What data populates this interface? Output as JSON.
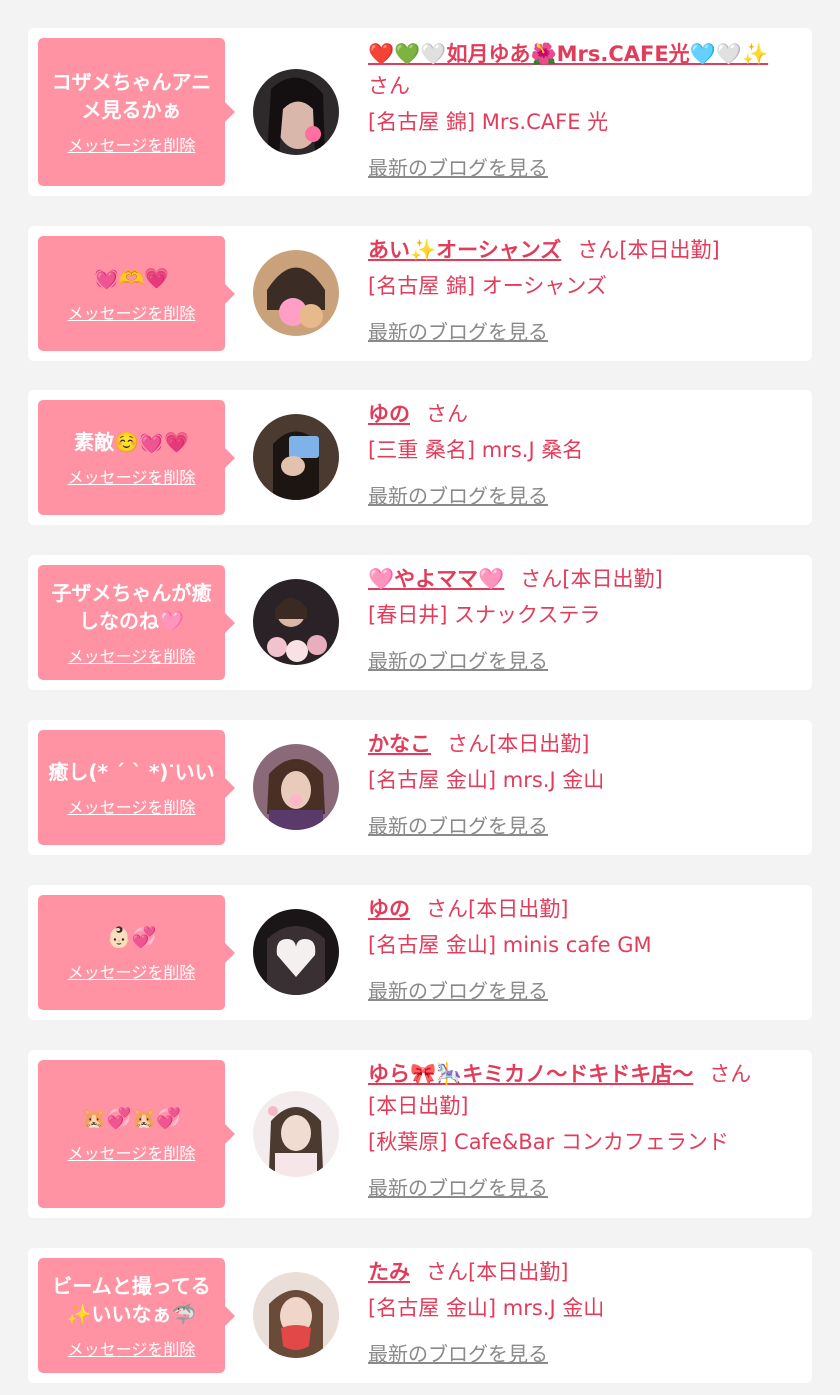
{
  "delete_label": "メッセージを削除",
  "blog_label": "最新のブログを見る",
  "san": "さん",
  "accent_color": "#e13d5b",
  "bubble_color": "#ff93a4",
  "items": [
    {
      "message": "コザメちゃんアニメ見るかぁ",
      "name": "❤️💚🤍如月ゆあ🌺Mrs.CAFE光🩵🤍✨",
      "status": "",
      "shop": "[名古屋 錦] Mrs.CAFE 光"
    },
    {
      "message": "💓🫶💗",
      "name": "あい✨オーシャンズ",
      "status": "[本日出勤]",
      "shop": "[名古屋 錦] オーシャンズ"
    },
    {
      "message": "素敵☺️💓💗",
      "name": "ゆの",
      "status": "",
      "shop": "[三重 桑名] mrs.J 桑名"
    },
    {
      "message": "子ザメちゃんが癒しなのね🩷",
      "name": "🩷やよママ🩷",
      "status": "[本日出勤]",
      "shop": "[春日井] スナックステラ"
    },
    {
      "message": "癒し(* ´ ` *)ᐝいい",
      "name": "かなこ",
      "status": "[本日出勤]",
      "shop": "[名古屋 金山] mrs.J 金山"
    },
    {
      "message": "👶🏻💞",
      "name": "ゆの",
      "status": "[本日出勤]",
      "shop": "[名古屋 金山] minis cafe GM"
    },
    {
      "message": "🐹💞🐹💞",
      "name": "ゆら🎀🎠キミカノ〜ドキドキ店〜",
      "status": "[本日出勤]",
      "shop": "[秋葉原] Cafe&Bar コンカフェランド"
    },
    {
      "message": "ビームと撮ってる✨いいなぁ🦈",
      "name": "たみ",
      "status": "[本日出勤]",
      "shop": "[名古屋 金山] mrs.J 金山"
    }
  ]
}
